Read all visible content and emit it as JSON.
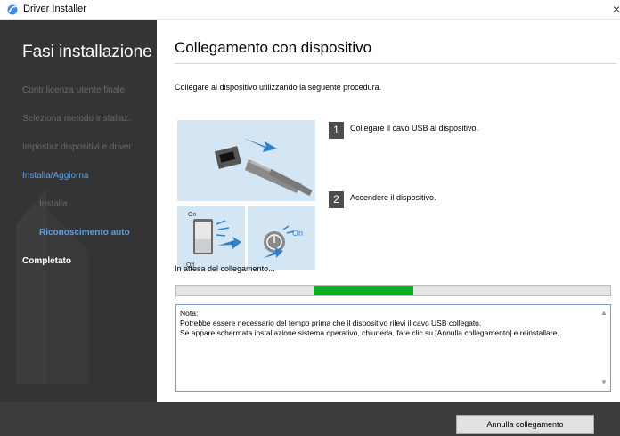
{
  "window": {
    "title": "Driver Installer",
    "close_glyph": "×",
    "icon": "driver-installer-icon"
  },
  "sidebar": {
    "heading": "Fasi installazione",
    "steps": [
      {
        "label": "Contr.licenza utente finale",
        "state": "done"
      },
      {
        "label": "Seleziona metodo installaz.",
        "state": "done"
      },
      {
        "label": "Impostaz.dispositivi e driver",
        "state": "done"
      },
      {
        "label": "Installa/Aggiorna",
        "state": "active"
      },
      {
        "label": "Installa",
        "state": "done"
      },
      {
        "label": "Riconoscimento auto",
        "state": "current"
      },
      {
        "label": "Completato",
        "state": "pending"
      }
    ]
  },
  "main": {
    "heading": "Collegamento con dispositivo",
    "intro": "Collegare al dispositivo utilizzando la seguente procedura.",
    "steps": [
      {
        "number": "1",
        "text": "Collegare il cavo USB al dispositivo."
      },
      {
        "number": "2",
        "text": "Accendere il dispositivo."
      }
    ],
    "illustrations": {
      "switch_on_label": "On",
      "switch_off_label": "Off",
      "power_on_label": "On"
    },
    "waiting_text": "In attesa del collegamento...",
    "progress_fraction": 0.23,
    "note": {
      "lines": [
        "Nota:",
        "Potrebbe essere necessario del tempo prima che il dispositivo rilevi il cavo USB collegato.",
        "Se appare schermata installazione sistema operativo, chiuderla, fare clic su [Annulla collegamento] e reinstallare."
      ]
    }
  },
  "footer": {
    "cancel_label": "Annulla collegamento"
  },
  "colors": {
    "sidebar_bg": "#343434",
    "accent_blue": "#59a0ec",
    "progress_green": "#06b025",
    "illustration_bg": "#d4e6f3",
    "footer_bg": "#3b3b3b"
  }
}
